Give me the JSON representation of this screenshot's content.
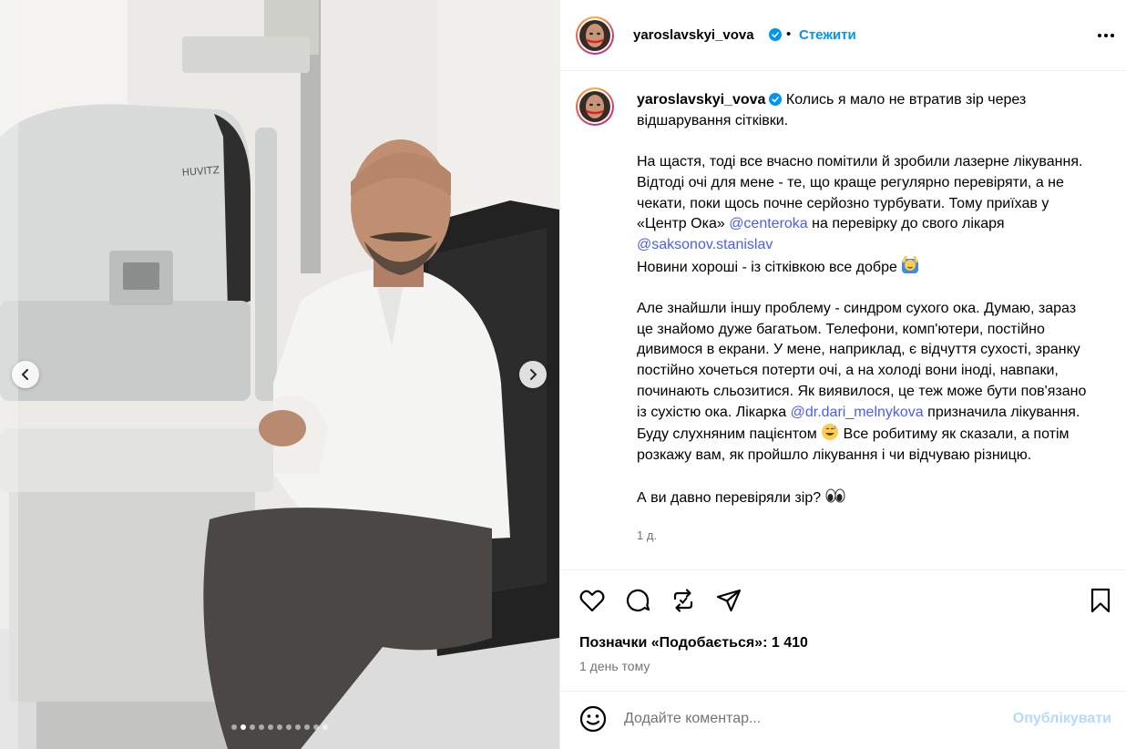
{
  "post": {
    "username": "yaroslavskyi_vova",
    "follow_label": "Стежити",
    "separator": "•",
    "caption": {
      "first_line": "Колись я мало не втратив зір через відшарування сітківки.",
      "p1_a": "На щастя, тоді все вчасно помітили й зробили лазерне лікування. Відтоді очі для мене - те, що краще регулярно перевіряти, а не чекати, поки щось почне серйозно турбувати. Тому приїхав у «Центр Ока» ",
      "mention1": "@centeroka",
      "p1_b": " на перевірку до свого лікаря ",
      "mention2": "@saksonov.stanislav",
      "p1_c": "Новини хороші - із сітківкою все добре ",
      "emoji1": "raising-hands-emoji",
      "p2_a": "Але знайшли іншу проблему - синдром сухого ока. Думаю, зараз це знайомо дуже багатьом. Телефони, комп'ютери, постійно дивимося в екрани. У мене, наприклад, є відчуття сухості, зранку постійно хочеться потерти очі, а на холоді вони іноді, навпаки, починають сльозитися. Як виявилося, це теж може бути пов'язано із сухістю ока. Лікарка ",
      "mention3": "@dr.dari_melnykova",
      "p2_b": " призначила лікування. Буду слухняним пацієнтом ",
      "emoji2": "sweat-smile-emoji",
      "p2_c": " Все робитиму як сказали, а потім розкажу вам, як пройшло лікування і чи відчуваю різницю.",
      "p3": "А ви давно перевіряли зір? ",
      "emoji3": "eyes-emoji"
    },
    "caption_age": "1 д.",
    "likes_text": "Позначки «Подобається»: 1 410",
    "posted_ago": "1 день тому"
  },
  "carousel": {
    "slide_count": 11,
    "active_index": 1
  },
  "comment": {
    "placeholder": "Додайте коментар...",
    "publish_label": "Опублікувати"
  },
  "colors": {
    "link": "#4a5df9",
    "follow": "#0095f6",
    "publish_disabled": "#b3dbff",
    "secondary_text": "#737373",
    "verified": "#0095f6"
  },
  "photo": {
    "device_brand": "HUVITZ"
  }
}
